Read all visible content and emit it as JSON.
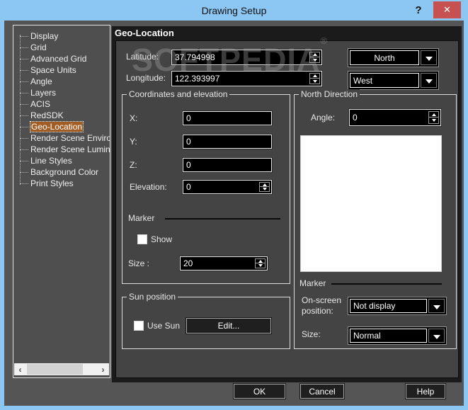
{
  "window": {
    "title": "Drawing Setup",
    "help": "?",
    "close": "✕"
  },
  "sidebar": {
    "items": [
      {
        "label": "Display"
      },
      {
        "label": "Grid"
      },
      {
        "label": "Advanced Grid"
      },
      {
        "label": "Space Units"
      },
      {
        "label": "Angle"
      },
      {
        "label": "Layers"
      },
      {
        "label": "ACIS"
      },
      {
        "label": "RedSDK"
      },
      {
        "label": "Geo-Location"
      },
      {
        "label": "Render Scene Environm"
      },
      {
        "label": "Render Scene Luminar"
      },
      {
        "label": "Line Styles"
      },
      {
        "label": "Background Color"
      },
      {
        "label": "Print Styles"
      }
    ]
  },
  "content": {
    "header": "Geo-Location",
    "watermark": {
      "text": "SOFTPEDIA",
      "reg": "®"
    },
    "latitude": {
      "label": "Latitude:",
      "value": "37.794998"
    },
    "longitude": {
      "label": "Longitude:",
      "value": "122.393997"
    },
    "lat_hemisphere": "North",
    "lon_hemisphere": "West",
    "coords_group": {
      "legend": "Coordinates and elevation",
      "x_label": "X:",
      "x_value": "0",
      "y_label": "Y:",
      "y_value": "0",
      "z_label": "Z:",
      "z_value": "0",
      "elevation_label": "Elevation:",
      "elevation_value": "0",
      "marker_label": "Marker",
      "show_label": "Show",
      "size_label": "Size :",
      "size_value": "20"
    },
    "sun_group": {
      "legend": "Sun position",
      "use_sun_label": "Use Sun",
      "edit_button": "Edit..."
    },
    "north_group": {
      "legend": "North Direction",
      "angle_label": "Angle:",
      "angle_value": "0",
      "marker_label": "Marker",
      "position_label_line1": "On-screen",
      "position_label_line2": "position:",
      "position_value": "Not display",
      "size_label": "Size:",
      "size_value": "Normal"
    }
  },
  "buttons": {
    "ok": "OK",
    "cancel": "Cancel",
    "help": "Help"
  },
  "colors": {
    "titlebar": "#8cc6f2",
    "close_button": "#c75050",
    "selection": "#a15d24"
  }
}
